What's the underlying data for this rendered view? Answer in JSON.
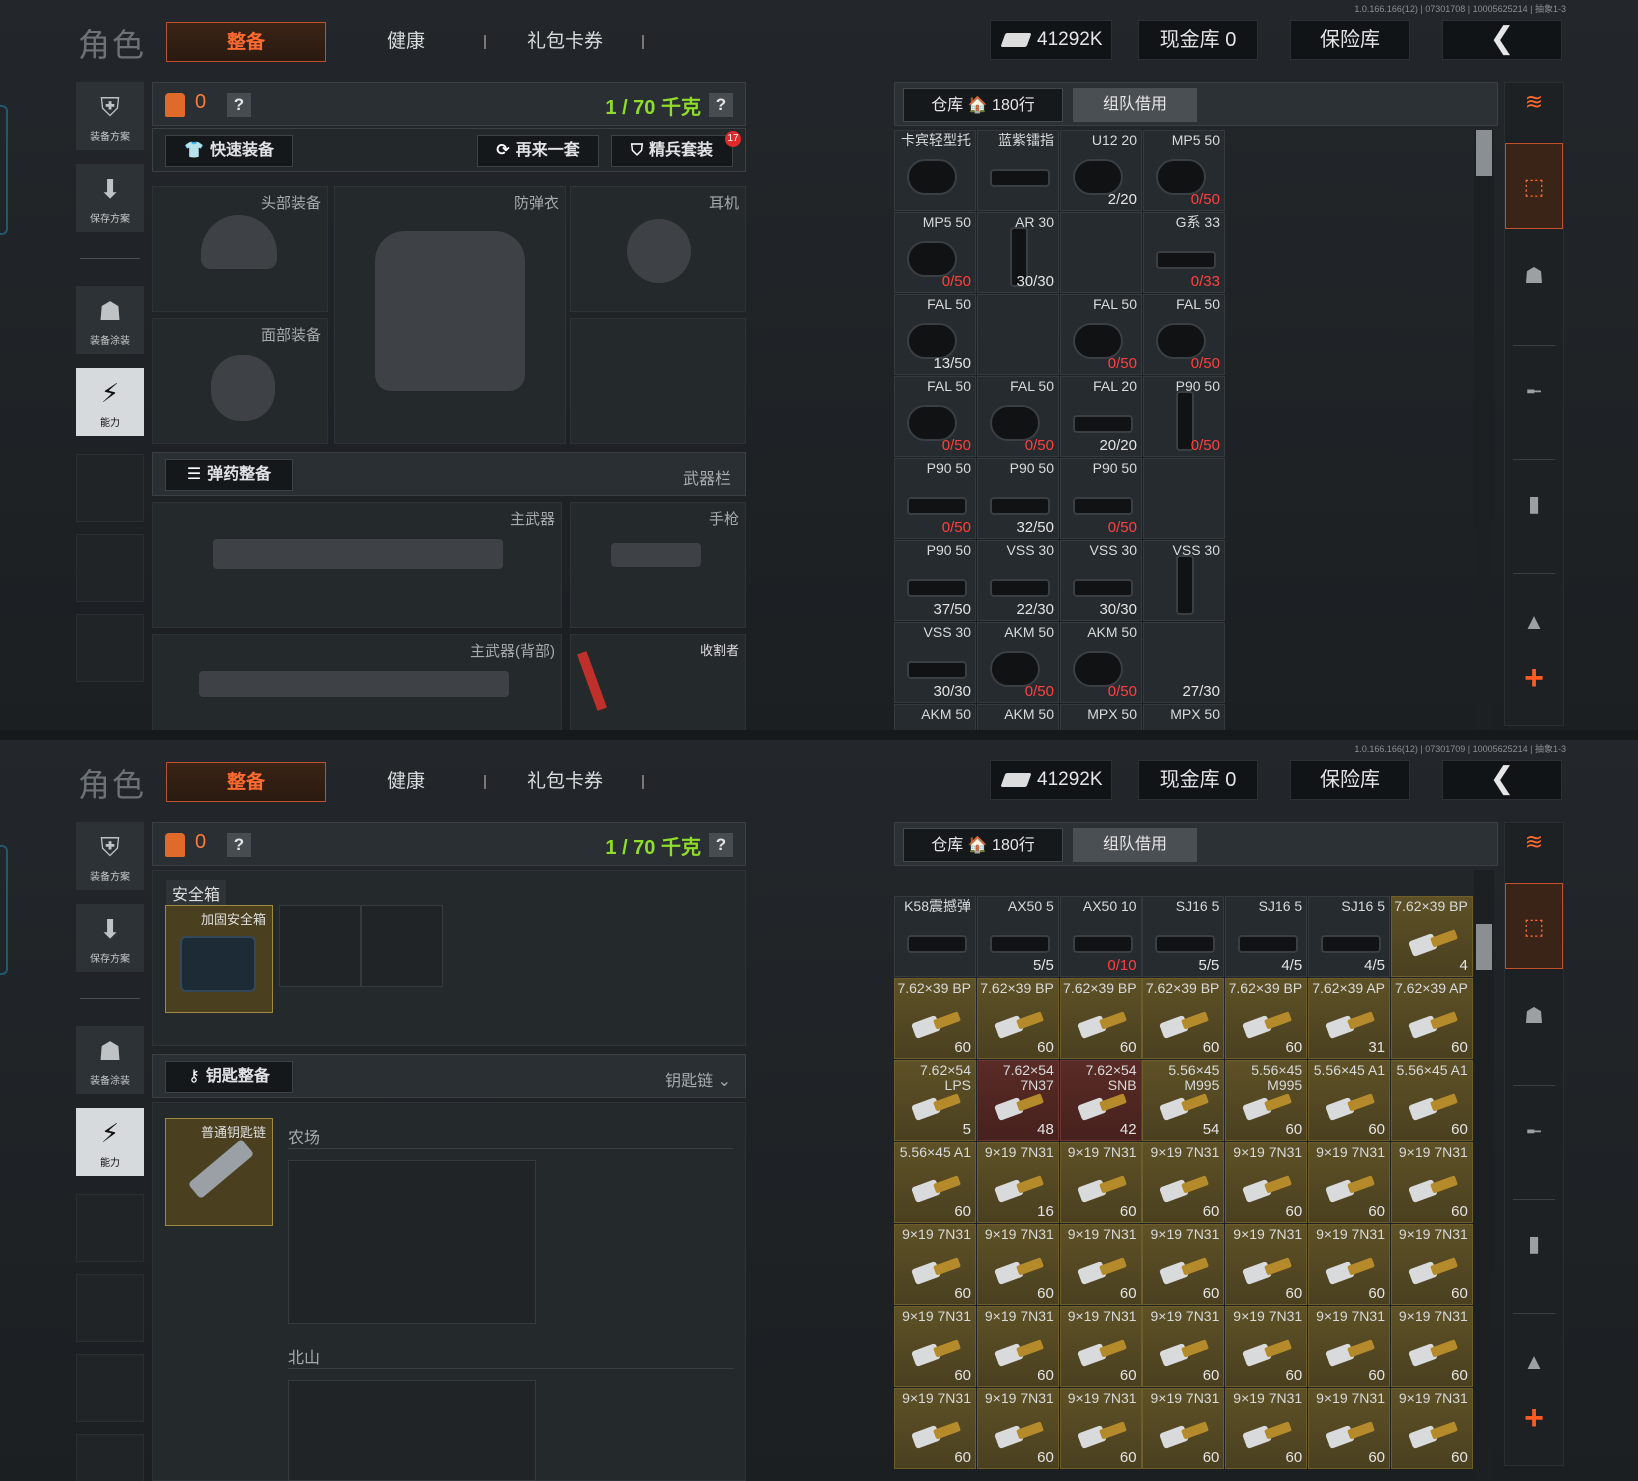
{
  "version_top": "1.0.166.166(12) | 07301708 | 10005625214 | 抽象1-3",
  "version_bottom": "1.0.166.166(12) | 07301709 | 10005625214 | 抽象1-3",
  "title": "角色",
  "tabs": [
    "整备",
    "健康",
    "礼包卡券"
  ],
  "money": "41292K",
  "cash_vault": "现金库 0",
  "safe_vault": "保险库",
  "back": "❮",
  "left_nav": [
    "装备方案",
    "保存方案",
    "装备涂装",
    "能力"
  ],
  "bag_count": "0",
  "weight": "1 / 70 千克",
  "help": "?",
  "quick_equip": "快速装备",
  "again": "再来一套",
  "elite": "精兵套装",
  "elite_badge": "17",
  "slots": {
    "head": "头部装备",
    "armor": "防弹衣",
    "headset": "耳机",
    "face": "面部装备",
    "primary": "主武器",
    "pistol": "手枪",
    "primary_back": "主武器(背部)",
    "melee": "收割者"
  },
  "ammo_header": "弹药整备",
  "weapon_bar": "武器栏",
  "warehouse_tab": "仓库 🏠 180行",
  "team_tab": "组队借用",
  "grid1": [
    {
      "n": "卡宾轻型托",
      "c": "",
      "t": "stock"
    },
    {
      "n": "蓝紫镭指",
      "c": "",
      "t": "mag"
    },
    {
      "n": "U12 20",
      "c": "2/20",
      "t": "drum"
    },
    {
      "n": "MP5 50",
      "c": "0/50",
      "r": true,
      "t": "drum"
    },
    {
      "n": "MP5 50",
      "c": "0/50",
      "r": true,
      "t": "drum"
    },
    {
      "n": "AR 30",
      "c": "30/30",
      "t": "tall"
    },
    {
      "n": "",
      "c": "",
      "t": "none"
    },
    {
      "n": "G系 33",
      "c": "0/33",
      "r": true,
      "t": "mag"
    },
    {
      "n": "FAL 50",
      "c": "13/50",
      "t": "drum"
    },
    {
      "n": "",
      "c": "",
      "t": "none"
    },
    {
      "n": "FAL 50",
      "c": "0/50",
      "r": true,
      "t": "drum"
    },
    {
      "n": "FAL 50",
      "c": "0/50",
      "r": true,
      "t": "drum"
    },
    {
      "n": "FAL 50",
      "c": "0/50",
      "r": true,
      "t": "drum"
    },
    {
      "n": "FAL 50",
      "c": "0/50",
      "r": true,
      "t": "drum"
    },
    {
      "n": "FAL 20",
      "c": "20/20",
      "t": "mag"
    },
    {
      "n": "P90 50",
      "c": "0/50",
      "r": true,
      "t": "tall"
    },
    {
      "n": "P90 50",
      "c": "0/50",
      "r": true,
      "t": "mag"
    },
    {
      "n": "P90 50",
      "c": "32/50",
      "t": "mag"
    },
    {
      "n": "P90 50",
      "c": "0/50",
      "r": true,
      "t": "mag"
    },
    {
      "n": "",
      "c": "",
      "t": "none"
    },
    {
      "n": "P90 50",
      "c": "37/50",
      "t": "mag"
    },
    {
      "n": "VSS 30",
      "c": "22/30",
      "t": "mag"
    },
    {
      "n": "VSS 30",
      "c": "30/30",
      "t": "mag"
    },
    {
      "n": "VSS 30",
      "c": "",
      "t": "tall"
    },
    {
      "n": "VSS 30",
      "c": "30/30",
      "t": "mag"
    },
    {
      "n": "AKM 50",
      "c": "0/50",
      "r": true,
      "t": "drum"
    },
    {
      "n": "AKM 50",
      "c": "0/50",
      "r": true,
      "t": "drum"
    },
    {
      "n": "",
      "c": "27/30",
      "t": "none"
    },
    {
      "n": "AKM 50",
      "c": "",
      "t": "none"
    },
    {
      "n": "AKM 50",
      "c": "",
      "t": "none"
    },
    {
      "n": "MPX 50",
      "c": "",
      "t": "none"
    },
    {
      "n": "MPX 50",
      "c": "",
      "t": "none"
    }
  ],
  "safe_label": "安全箱",
  "safe_item": "加固安全箱",
  "key_header": "钥匙整备",
  "key_chain": "钥匙链",
  "key_item": "普通钥匙链",
  "farm": "农场",
  "north": "北山",
  "grid2": [
    {
      "n": "K58震撼弹",
      "c": "",
      "g": 0
    },
    {
      "n": "AX50 5",
      "c": "5/5",
      "g": 0
    },
    {
      "n": "AX50 10",
      "c": "0/10",
      "r": true,
      "g": 0
    },
    {
      "n": "SJ16 5",
      "c": "5/5",
      "g": 0
    },
    {
      "n": "SJ16 5",
      "c": "4/5",
      "g": 0
    },
    {
      "n": "SJ16 5",
      "c": "4/5",
      "g": 0
    },
    {
      "n": "7.62×39 BP",
      "c": "4",
      "g": 1
    },
    {
      "n": "7.62×39 BP",
      "c": "60",
      "g": 1
    },
    {
      "n": "7.62×39 BP",
      "c": "60",
      "g": 1
    },
    {
      "n": "7.62×39 BP",
      "c": "60",
      "g": 1
    },
    {
      "n": "7.62×39 BP",
      "c": "60",
      "g": 1
    },
    {
      "n": "7.62×39 BP",
      "c": "60",
      "g": 1
    },
    {
      "n": "7.62×39 AP",
      "c": "31",
      "g": 1
    },
    {
      "n": "7.62×39 AP",
      "c": "60",
      "g": 1
    },
    {
      "n": "7.62×54 LPS",
      "c": "5",
      "g": 1
    },
    {
      "n": "7.62×54 7N37",
      "c": "48",
      "g": 2
    },
    {
      "n": "7.62×54 SNB",
      "c": "42",
      "g": 2
    },
    {
      "n": "5.56×45 M995",
      "c": "54",
      "g": 1
    },
    {
      "n": "5.56×45 M995",
      "c": "60",
      "g": 1
    },
    {
      "n": "5.56×45 A1",
      "c": "60",
      "g": 1
    },
    {
      "n": "5.56×45 A1",
      "c": "60",
      "g": 1
    },
    {
      "n": "5.56×45 A1",
      "c": "60",
      "g": 1
    },
    {
      "n": "9×19 7N31",
      "c": "16",
      "g": 1
    },
    {
      "n": "9×19 7N31",
      "c": "60",
      "g": 1
    },
    {
      "n": "9×19 7N31",
      "c": "60",
      "g": 1
    },
    {
      "n": "9×19 7N31",
      "c": "60",
      "g": 1
    },
    {
      "n": "9×19 7N31",
      "c": "60",
      "g": 1
    },
    {
      "n": "9×19 7N31",
      "c": "60",
      "g": 1
    },
    {
      "n": "9×19 7N31",
      "c": "60",
      "g": 1
    },
    {
      "n": "9×19 7N31",
      "c": "60",
      "g": 1
    },
    {
      "n": "9×19 7N31",
      "c": "60",
      "g": 1
    },
    {
      "n": "9×19 7N31",
      "c": "60",
      "g": 1
    },
    {
      "n": "9×19 7N31",
      "c": "60",
      "g": 1
    },
    {
      "n": "9×19 7N31",
      "c": "60",
      "g": 1
    },
    {
      "n": "9×19 7N31",
      "c": "60",
      "g": 1
    },
    {
      "n": "9×19 7N31",
      "c": "60",
      "g": 1
    },
    {
      "n": "9×19 7N31",
      "c": "60",
      "g": 1
    },
    {
      "n": "9×19 7N31",
      "c": "60",
      "g": 1
    },
    {
      "n": "9×19 7N31",
      "c": "60",
      "g": 1
    },
    {
      "n": "9×19 7N31",
      "c": "60",
      "g": 1
    },
    {
      "n": "9×19 7N31",
      "c": "60",
      "g": 1
    },
    {
      "n": "9×19 7N31",
      "c": "60",
      "g": 1
    },
    {
      "n": "9×19 7N31",
      "c": "60",
      "g": 1
    },
    {
      "n": "9×19 7N31",
      "c": "60",
      "g": 1
    },
    {
      "n": "9×19 7N31",
      "c": "60",
      "g": 1
    },
    {
      "n": "9×19 7N31",
      "c": "60",
      "g": 1
    },
    {
      "n": "9×19 7N31",
      "c": "60",
      "g": 1
    },
    {
      "n": "9×19 7N31",
      "c": "60",
      "g": 1
    },
    {
      "n": "9×19 7N31",
      "c": "60",
      "g": 1
    }
  ]
}
